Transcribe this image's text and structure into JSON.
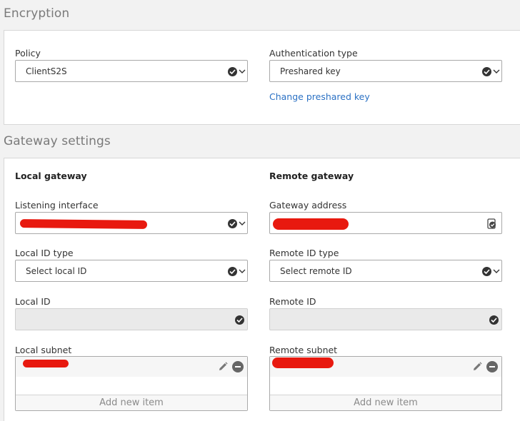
{
  "encryption": {
    "title": "Encryption",
    "policy_label": "Policy",
    "policy_value": "ClientS2S",
    "auth_label": "Authentication type",
    "auth_value": "Preshared key",
    "change_key_link": "Change preshared key"
  },
  "gateway": {
    "title": "Gateway settings",
    "local": {
      "heading": "Local gateway",
      "listening_label": "Listening interface",
      "id_type_label": "Local ID type",
      "id_type_value": "Select local ID",
      "id_label": "Local ID",
      "subnet_label": "Local subnet",
      "add_item": "Add new item"
    },
    "remote": {
      "heading": "Remote gateway",
      "address_label": "Gateway address",
      "id_type_label": "Remote ID type",
      "id_type_value": "Select remote ID",
      "id_label": "Remote ID",
      "subnet_label": "Remote subnet",
      "add_item": "Add new item"
    }
  },
  "icons": {
    "dropdown_check": "check-circle-icon",
    "dropdown_caret": "chevron-down-icon",
    "edit": "pencil-icon",
    "remove": "minus-circle-icon",
    "address_book": "address-book-icon"
  },
  "colors": {
    "link": "#2b71c4",
    "redaction": "#e8190f",
    "panel_bg": "#ffffff",
    "page_bg": "#f2f2f2"
  }
}
